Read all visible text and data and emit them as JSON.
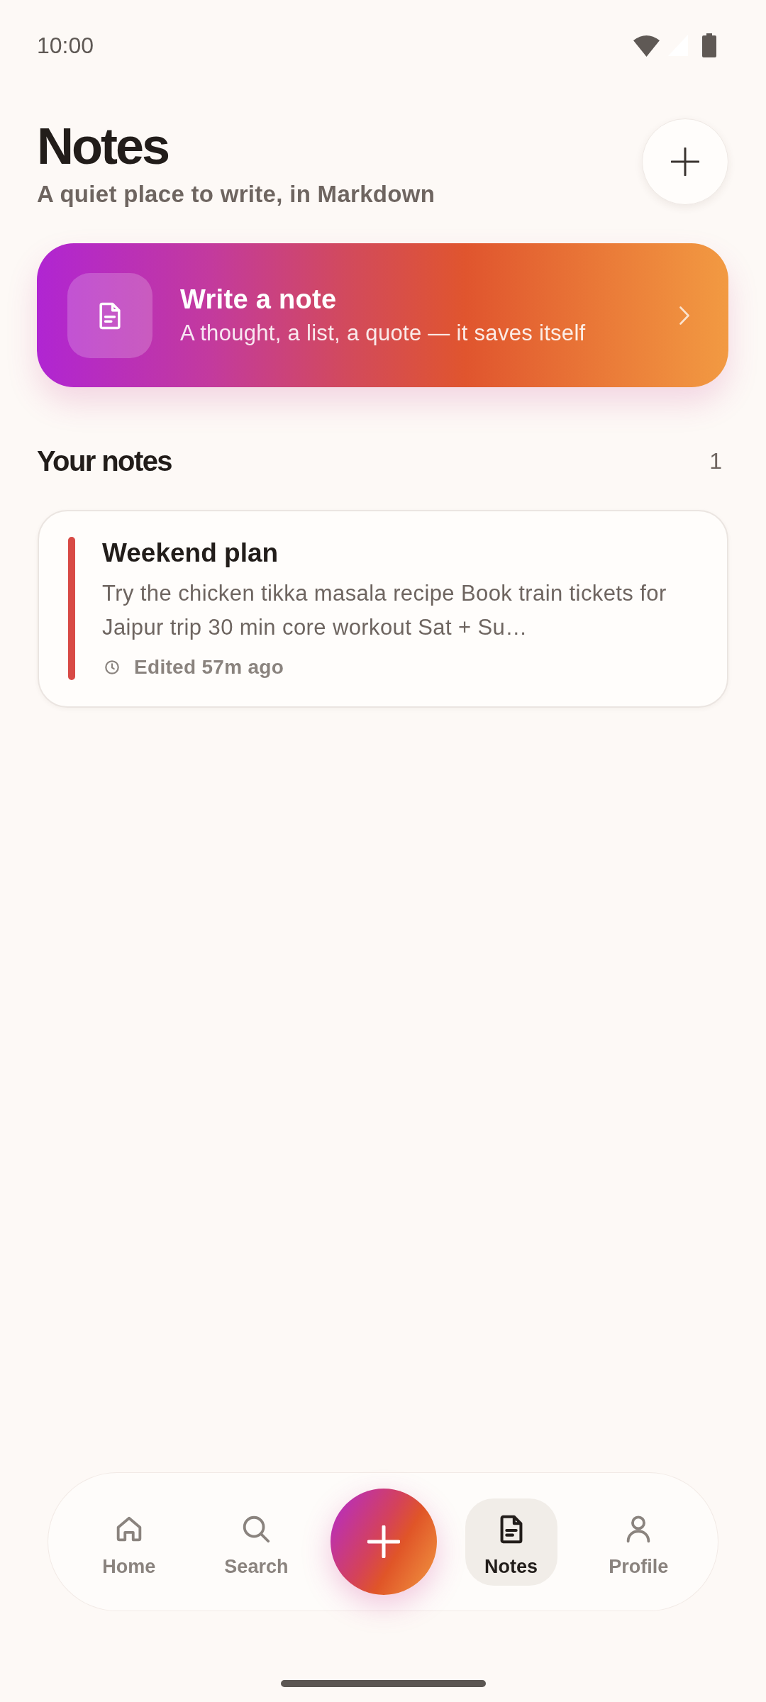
{
  "status_bar": {
    "time": "10:00"
  },
  "header": {
    "title": "Notes",
    "subtitle": "A quiet place to write, in Markdown"
  },
  "new_note_banner": {
    "title": "Write a note",
    "subtitle": "A thought, a list, a quote — it saves itself"
  },
  "notes_section": {
    "heading": "Your notes",
    "count": "1",
    "notes": [
      {
        "title": "Weekend plan",
        "preview": "Try the chicken tikka masala recipe Book train tickets for Jaipur trip 30 min core workout Sat + Su…",
        "edited": "Edited 57m ago",
        "color": "#d84a45"
      }
    ]
  },
  "bottom_nav": {
    "items": [
      {
        "kind": "home",
        "label": "Home",
        "selected": false
      },
      {
        "kind": "search",
        "label": "Search",
        "selected": false
      },
      {
        "kind": "compose"
      },
      {
        "kind": "notes",
        "label": "Notes",
        "selected": true
      },
      {
        "kind": "profile",
        "label": "Profile",
        "selected": false
      }
    ]
  }
}
